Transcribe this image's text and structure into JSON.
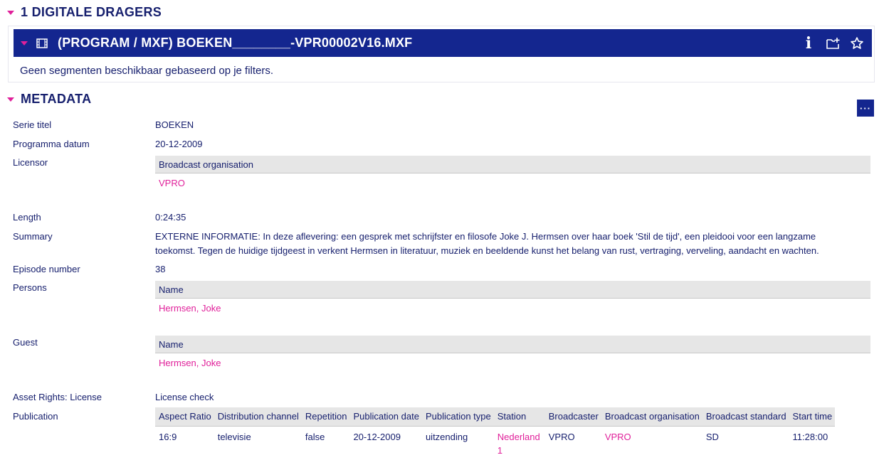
{
  "digital_carriers": {
    "section_title": "1 DIGITALE DRAGERS",
    "carrier_title": "(PROGRAM / MXF) BOEKEN________-VPR00002V16.MXF",
    "empty_message": "Geen segmenten beschikbaar gebaseerd op je filters.",
    "info_icon_glyph": "i"
  },
  "metadata": {
    "section_title": "METADATA",
    "more_button": "···",
    "serie_titel_label": "Serie titel",
    "serie_titel_value": "BOEKEN",
    "programma_datum_label": "Programma datum",
    "programma_datum_value": "20-12-2009",
    "licensor_label": "Licensor",
    "licensor_table_header": "Broadcast organisation",
    "licensor_table_value": "VPRO",
    "length_label": "Length",
    "length_value": "0:24:35",
    "summary_label": "Summary",
    "summary_value": "EXTERNE INFORMATIE: In deze aflevering: een gesprek met schrijfster en filosofe Joke J. Hermsen over haar boek 'Stil de tijd', een pleidooi voor een langzame toekomst. Tegen de huidige tijdgeest in verkent Hermsen in literatuur, muziek en beeldende kunst het belang van rust, vertraging, verveling, aandacht en wachten.",
    "episode_number_label": "Episode number",
    "episode_number_value": "38",
    "persons_label": "Persons",
    "persons_table_header": "Name",
    "persons_table_value": "Hermsen, Joke",
    "guest_label": "Guest",
    "guest_table_header": "Name",
    "guest_table_value": "Hermsen, Joke",
    "asset_rights_label": "Asset Rights: License",
    "asset_rights_value": "License check",
    "publication_label": "Publication",
    "publication_headers": [
      "Aspect Ratio",
      "Distribution channel",
      "Repetition",
      "Publication date",
      "Publication type",
      "Station",
      "Broadcaster",
      "Broadcast organisation",
      "Broadcast standard",
      "Start time"
    ],
    "publication_row": {
      "aspect_ratio": "16:9",
      "distribution_channel": "televisie",
      "repetition": "false",
      "publication_date": "20-12-2009",
      "publication_type": "uitzending",
      "station": "Nederland 1",
      "broadcaster": "VPRO",
      "broadcast_organisation": "VPRO",
      "broadcast_standard": "SD",
      "start_time": "11:28:00"
    }
  },
  "colors": {
    "primary_navy": "#14268f",
    "text_navy": "#17206e",
    "accent_magenta": "#e0209a",
    "header_gray": "#e6e6e6"
  },
  "icons": [
    "caret-down-icon",
    "film-icon",
    "info-icon",
    "add-to-folder-icon",
    "star-icon",
    "more-icon"
  ]
}
